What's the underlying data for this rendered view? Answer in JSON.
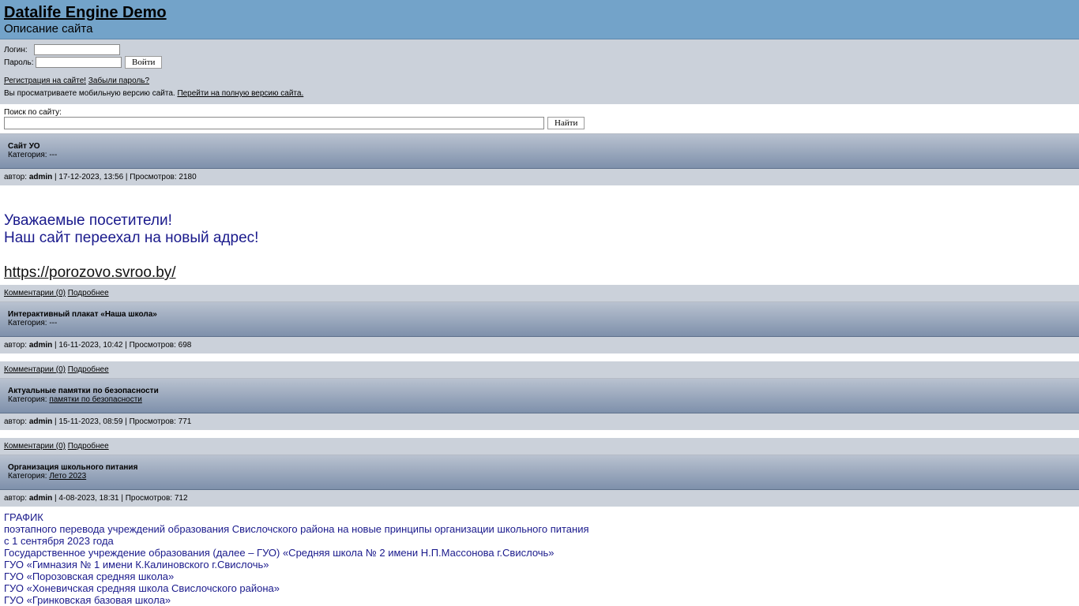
{
  "header": {
    "title": "Datalife Engine Demo",
    "description": "Описание сайта"
  },
  "login": {
    "login_label": "Логин:",
    "password_label": "Пароль:",
    "login_value": "",
    "password_value": "",
    "submit_label": "Войти",
    "register_link": "Регистрация на сайте!",
    "forgot_link": "Забыли пароль?",
    "mobile_note": "Вы просматриваете мобильную версию сайта.",
    "full_version_link": "Перейти на полную версию сайта."
  },
  "search": {
    "label": "Поиск по сайту:",
    "value": "",
    "button_label": "Найти"
  },
  "meta_labels": {
    "author_prefix": "автор:",
    "category_prefix": "Категория:",
    "comments_link": "Комментарии (0)",
    "more_link": "Подробнее"
  },
  "posts": [
    {
      "title": "Сайт УО",
      "category": "---",
      "author": "admin",
      "date_views": "| 17-12-2023, 13:56 | Просмотров: 2180",
      "body": {
        "line1": "Уважаемые посетители!",
        "line2": "Наш сайт переехал на новый адрес!",
        "link": "https://porozovo.svroo.by/"
      }
    },
    {
      "title": "Интерактивный плакат «Наша школа»",
      "category": "---",
      "author": "admin",
      "date_views": "| 16-11-2023, 10:42 | Просмотров: 698"
    },
    {
      "title": "Актуальные памятки по безопасности",
      "category": "памятки по безопасности",
      "author": "admin",
      "date_views": "| 15-11-2023, 08:59 | Просмотров: 771"
    },
    {
      "title": "Организация школьного питания",
      "category": "Лето 2023",
      "author": "admin",
      "date_views": "| 4-08-2023, 18:31 | Просмотров: 712",
      "body_lines": [
        "ГРАФИК",
        "поэтапного перевода учреждений образования Свислочского района на новые принципы организации школьного питания",
        "с 1 сентября 2023 года",
        "Государственное учреждение образования (далее – ГУО) «Средняя школа № 2 имени Н.П.Массонова г.Свислочь»",
        "ГУО «Гимназия № 1 имени К.Калиновского г.Свислочь»",
        "ГУО «Порозовская средняя школа»",
        "ГУО «Хоневичская средняя школа Свислочского района»",
        "ГУО «Гринковская базовая школа»"
      ]
    }
  ]
}
